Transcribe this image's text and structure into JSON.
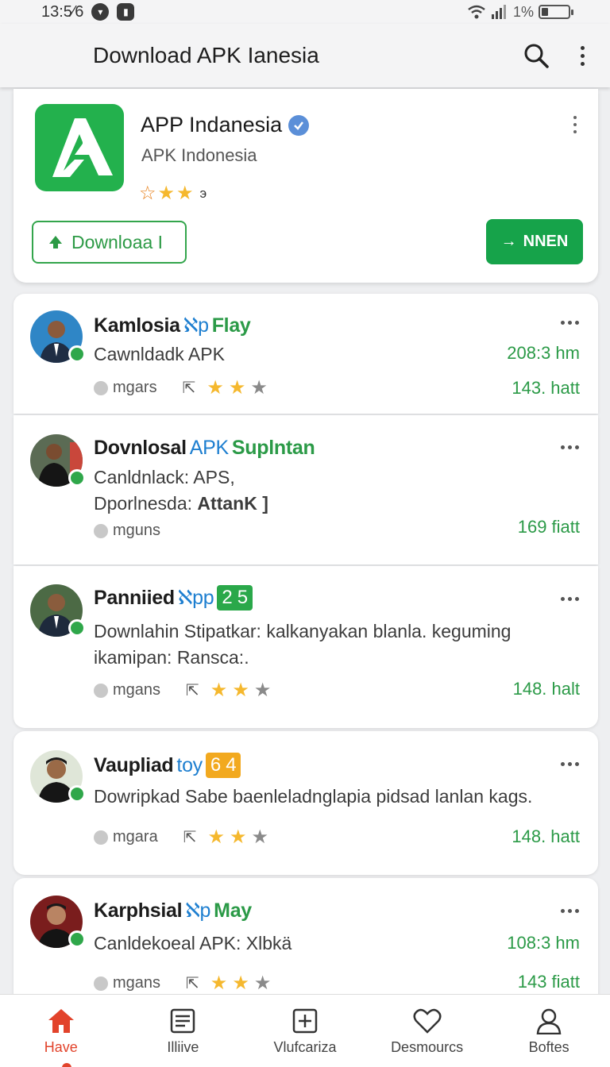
{
  "status_bar": {
    "time": "13:5⁄6",
    "battery_text": "1%"
  },
  "app_bar": {
    "title": "Download APK Ianesia",
    "search_icon": "search-icon",
    "more_icon": "more-vert-icon"
  },
  "app_card": {
    "name": "APP Indanesia",
    "developer": "APK Indonesia",
    "rating_count": "э",
    "download_label": "Downloaa I",
    "secondary_label": "NNEN",
    "accent": "#16a34a"
  },
  "posts": [
    {
      "author": "Kamlosia",
      "handle": "ℵp",
      "handle_suffix": "Flay",
      "text": "Cawnldadk APK",
      "right_top": "208:3 hm",
      "reactions": "mgars",
      "right_bottom": "143. hatt",
      "stars": 2
    },
    {
      "author": "Dovnlosal",
      "handle": "APK",
      "handle_suffix": "Suplntan",
      "text_line1": "Canldnlack: APS,",
      "text_line2_prefix": "Dporlnesda: ",
      "text_line2_bold": "AttanK ]",
      "reactions": "mguns",
      "right_bottom": "169 fiatt"
    },
    {
      "author": "Panniied",
      "handle": "ℵpp",
      "tag": "2 5",
      "text": "Downlahin Stipatkar: kalkanyakan blanla. keguming ikamipan: Ransca:.",
      "reactions": "mgans",
      "right_bottom": "148. halt",
      "stars": 2
    },
    {
      "author": "Vaupliad",
      "handle": "toy",
      "tag": "6 4",
      "text": "Dowripkad Sabe baenleladnglapia pidsad lanlan kags.",
      "reactions": "mgara",
      "right_bottom": "148. hatt",
      "stars": 2
    },
    {
      "author": "Karphsial",
      "handle": "ℵp",
      "handle_suffix": "May",
      "text": "Canldekoeal APK: Xlbkä",
      "right_top": "108:3 hm",
      "reactions": "mgans",
      "right_bottom": "143 fiatt",
      "stars": 2
    }
  ],
  "bottom_nav": [
    {
      "label": "Have",
      "icon": "home-icon",
      "active": true
    },
    {
      "label": "Illiive",
      "icon": "list-icon",
      "active": false
    },
    {
      "label": "Vlufcariza",
      "icon": "add-box-icon",
      "active": false
    },
    {
      "label": "Desmourcs",
      "icon": "heart-icon",
      "active": false
    },
    {
      "label": "Boftes",
      "icon": "profile-icon",
      "active": false
    }
  ]
}
